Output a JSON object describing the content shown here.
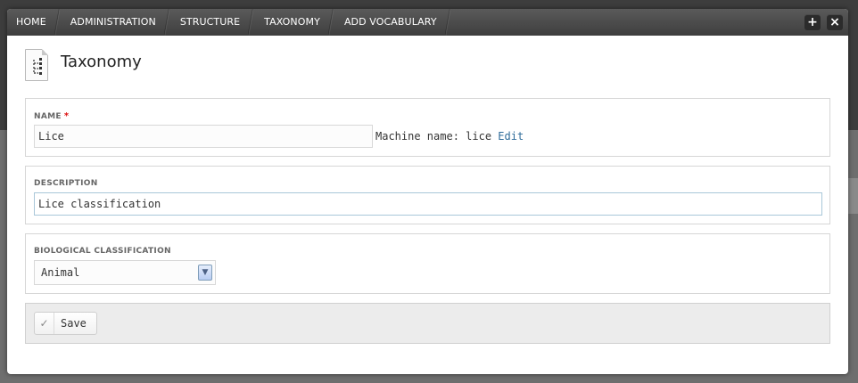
{
  "breadcrumbs": [
    "HOME",
    "ADMINISTRATION",
    "STRUCTURE",
    "TAXONOMY",
    "ADD VOCABULARY"
  ],
  "toolbar": {
    "add_icon": "+",
    "close_icon": "×"
  },
  "page": {
    "title": "Taxonomy",
    "icon": "taxonomy-page-icon"
  },
  "form": {
    "name": {
      "label": "NAME",
      "required_mark": "*",
      "value": "Lice",
      "machine_name_prefix": "Machine name: lice",
      "machine_name_edit": "Edit"
    },
    "description": {
      "label": "DESCRIPTION",
      "value": "Lice classification"
    },
    "biological_classification": {
      "label": "BIOLOGICAL CLASSIFICATION",
      "selected": "Animal",
      "arrow": "▼"
    },
    "actions": {
      "save_label": "Save",
      "save_icon": "✓"
    }
  },
  "colors": {
    "toolbar": "#4a4a4a",
    "link": "#2f6c9a",
    "required": "#dd1111",
    "actions_bg": "#ececec"
  }
}
